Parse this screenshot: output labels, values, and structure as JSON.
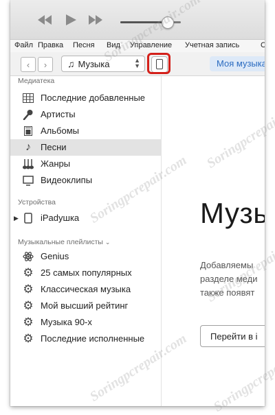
{
  "menubar": {
    "items": [
      "Файл",
      "Правка",
      "Песня",
      "Вид",
      "Управление",
      "Учетная запись",
      "С"
    ]
  },
  "player": {
    "volume_level": 0.72
  },
  "toolbar": {
    "back_symbol": "‹",
    "forward_symbol": "›",
    "media_kind": "Музыка",
    "my_music_tab": "Моя музыка"
  },
  "sidebar": {
    "library_header": "Медиатека",
    "library_items": [
      {
        "label": "Последние добавленные",
        "icon": "grid-icon"
      },
      {
        "label": "Артисты",
        "icon": "microphone-icon"
      },
      {
        "label": "Альбомы",
        "icon": "album-icon"
      },
      {
        "label": "Песни",
        "icon": "music-note-icon",
        "selected": true
      },
      {
        "label": "Жанры",
        "icon": "guitars-icon"
      },
      {
        "label": "Видеоклипы",
        "icon": "monitor-icon"
      }
    ],
    "devices_header": "Устройства",
    "device_name": "iPadушка",
    "playlists_header": "Музыкальные плейлисты",
    "playlists": [
      {
        "label": "Genius",
        "icon": "genius-atom-icon"
      },
      {
        "label": "25 самых популярных",
        "icon": "gear-icon"
      },
      {
        "label": "Классическая музыка",
        "icon": "gear-icon"
      },
      {
        "label": "Мой высший рейтинг",
        "icon": "gear-icon"
      },
      {
        "label": "Музыка 90-х",
        "icon": "gear-icon"
      },
      {
        "label": "Последние исполненные",
        "icon": "gear-icon"
      }
    ]
  },
  "main": {
    "title": "Музы",
    "description_lines": [
      "Добавляемы",
      "разделе меди",
      "также появят"
    ],
    "goto_button": "Перейти в i"
  },
  "watermark": "Soringpcrepair.com",
  "colors": {
    "accent_blue": "#2a6bc0",
    "highlight_red": "#d4201a",
    "selected_row": "#e3e3e3"
  }
}
